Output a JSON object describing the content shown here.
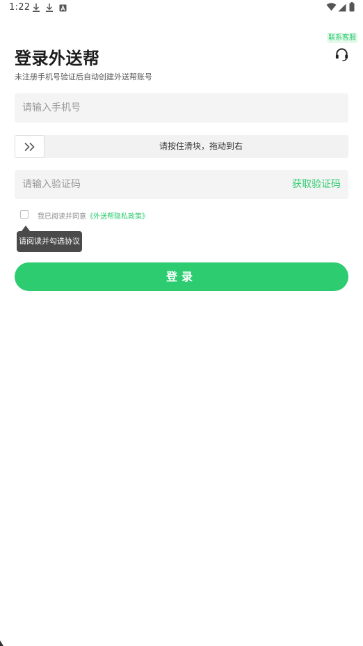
{
  "status_bar": {
    "time": "1:22",
    "icons": [
      "download-icon",
      "download-icon",
      "a-icon",
      "wifi-icon",
      "signal-icon",
      "battery-icon"
    ]
  },
  "header": {
    "service_label": "联系客服",
    "title": "登录外送帮",
    "subtitle": "未注册手机号验证后自动创建外送帮账号"
  },
  "form": {
    "phone_placeholder": "请输入手机号",
    "phone_value": "",
    "slider_label": "请按住滑块，拖动到右",
    "code_placeholder": "请输入验证码",
    "code_value": "",
    "get_code_label": "获取验证码"
  },
  "agreement": {
    "checked": false,
    "prefix": "我已阅读并同意",
    "policy_link": "《外送帮隐私政策》",
    "tooltip": "请阅读并勾选协议"
  },
  "login_label": "登录",
  "colors": {
    "accent": "#2ecc71",
    "badge_bg": "#e6f8ec",
    "input_bg": "#f4f4f4",
    "tooltip_bg": "#4a4a4a"
  }
}
